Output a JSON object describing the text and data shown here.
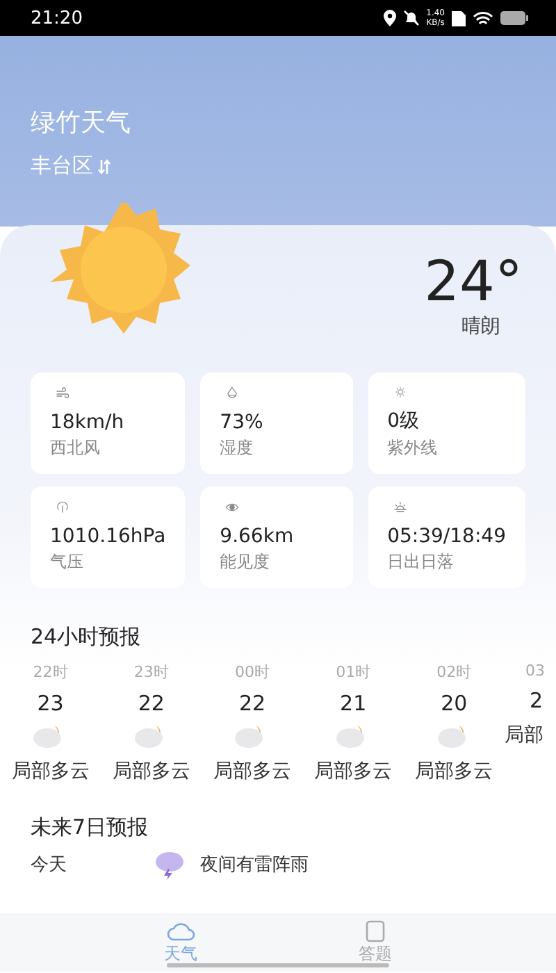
{
  "status_bar": {
    "time": "21:20",
    "speed": "1.40",
    "speed_unit": "KB/s"
  },
  "app_title": "绿竹天气",
  "location": "丰台区",
  "current": {
    "temperature": "24°",
    "condition": "晴朗"
  },
  "details": [
    {
      "kind": "wind",
      "value": "18km/h",
      "label": "西北风"
    },
    {
      "kind": "humidity",
      "value": "73%",
      "label": "湿度"
    },
    {
      "kind": "uv",
      "value": "0级",
      "label": "紫外线"
    },
    {
      "kind": "pressure",
      "value": "1010.16hPa",
      "label": "气压"
    },
    {
      "kind": "visibility",
      "value": "9.66km",
      "label": "能见度"
    },
    {
      "kind": "sunrise",
      "value": "05:39/18:49",
      "label": "日出日落"
    }
  ],
  "hourly": {
    "title": "24小时预报",
    "items": [
      {
        "time": "22时",
        "temp": "23",
        "desc": "局部多云",
        "cut_off": false
      },
      {
        "time": "23时",
        "temp": "22",
        "desc": "局部多云",
        "cut_off": false
      },
      {
        "time": "00时",
        "temp": "22",
        "desc": "局部多云",
        "cut_off": false
      },
      {
        "time": "01时",
        "temp": "21",
        "desc": "局部多云",
        "cut_off": false
      },
      {
        "time": "02时",
        "temp": "20",
        "desc": "局部多云",
        "cut_off": false
      },
      {
        "time": "03",
        "temp": "2",
        "desc": "局部",
        "cut_off": true
      }
    ]
  },
  "daily": {
    "title": "未来7日预报",
    "items": [
      {
        "day": "今天",
        "desc": "夜间有雷阵雨"
      }
    ]
  },
  "nav": [
    {
      "label": "天气",
      "kind": "weather",
      "selected": true
    },
    {
      "label": "答题",
      "kind": "quiz",
      "selected": false
    }
  ]
}
